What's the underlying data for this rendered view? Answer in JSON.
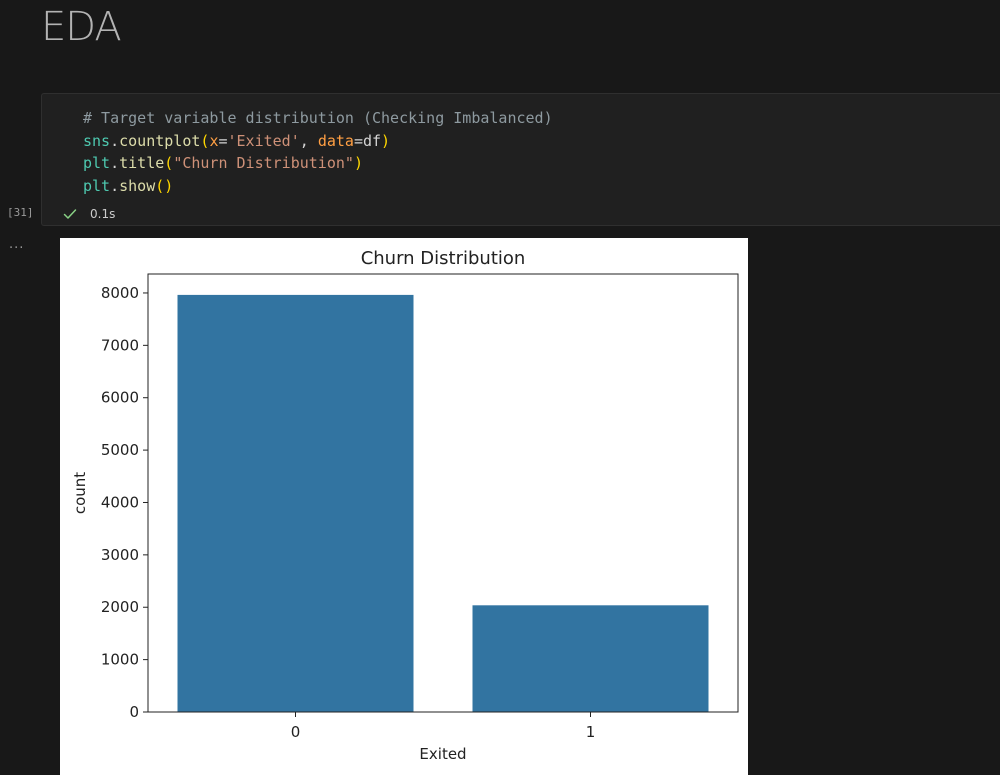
{
  "notebook": {
    "heading": "EDA",
    "cell": {
      "code_lines": [
        [
          {
            "t": "# Target variable distribution (Checking Imbalanced)",
            "c": "t-comment"
          }
        ],
        [
          {
            "t": "sns",
            "c": "t-ident"
          },
          {
            "t": ".",
            "c": "t-punct"
          },
          {
            "t": "countplot",
            "c": "t-func"
          },
          {
            "t": "(",
            "c": "t-paren"
          },
          {
            "t": "x",
            "c": "t-param"
          },
          {
            "t": "=",
            "c": "t-punct"
          },
          {
            "t": "'Exited'",
            "c": "t-string"
          },
          {
            "t": ", ",
            "c": "t-punct"
          },
          {
            "t": "data",
            "c": "t-param"
          },
          {
            "t": "=df",
            "c": "t-plain"
          },
          {
            "t": ")",
            "c": "t-paren"
          }
        ],
        [
          {
            "t": "plt",
            "c": "t-ident"
          },
          {
            "t": ".",
            "c": "t-punct"
          },
          {
            "t": "title",
            "c": "t-func"
          },
          {
            "t": "(",
            "c": "t-paren"
          },
          {
            "t": "\"Churn Distribution\"",
            "c": "t-string"
          },
          {
            "t": ")",
            "c": "t-paren"
          }
        ],
        [
          {
            "t": "plt",
            "c": "t-ident"
          },
          {
            "t": ".",
            "c": "t-punct"
          },
          {
            "t": "show",
            "c": "t-func"
          },
          {
            "t": "()",
            "c": "t-paren"
          }
        ]
      ],
      "execution_count": "[31]",
      "status_time": "0.1s",
      "output_menu": "..."
    }
  },
  "colors": {
    "background": "#181818",
    "bar": "#3274a1",
    "success": "#89d185"
  },
  "chart_data": {
    "type": "bar",
    "title": "Churn Distribution",
    "xlabel": "Exited",
    "ylabel": "count",
    "categories": [
      "0",
      "1"
    ],
    "values": [
      7963,
      2037
    ],
    "ylim": [
      0,
      8362
    ],
    "yticks": [
      0,
      1000,
      2000,
      3000,
      4000,
      5000,
      6000,
      7000,
      8000
    ],
    "grid": false,
    "legend": "none"
  }
}
